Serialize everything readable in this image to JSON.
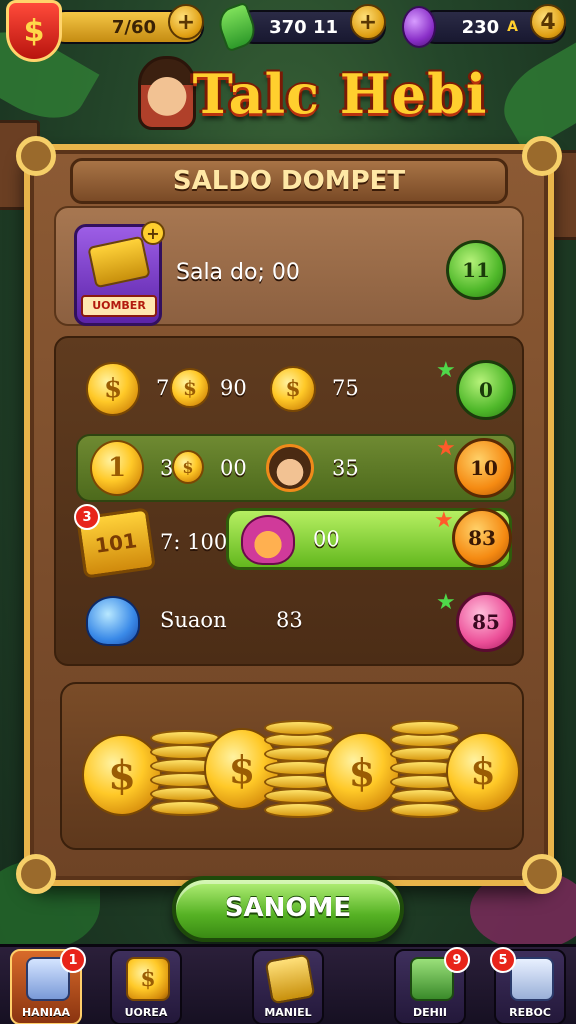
{
  "top_bar": {
    "gold_value": "7/60",
    "leaf_value": "370 11",
    "gem_value": "230",
    "gem_suffix": "A",
    "plus_label": "+",
    "gem_plus_label": "4"
  },
  "title": "Talc Hebi",
  "panel": {
    "header": "SALDO DOMPET",
    "wallet_badge": "UOMBER",
    "wallet_label": "Sala do; 00",
    "wallet_button": "11",
    "rows": [
      {
        "text_a": "7",
        "text_b": "90",
        "text_c": "75",
        "button": "0"
      },
      {
        "text_a": "3",
        "text_b": "00",
        "text_c": "35",
        "button": "10"
      },
      {
        "text_a": "7: 100",
        "text_b": "00",
        "button": "83",
        "dot": "3",
        "cash": "101"
      },
      {
        "text_a": "Suaon",
        "text_b": "83",
        "button": "85"
      }
    ]
  },
  "action_button": "SANOME",
  "bottom_nav": [
    {
      "label": "HANIAA",
      "badge": "1"
    },
    {
      "label": "UOREA"
    },
    {
      "label": "MANIEL"
    },
    {
      "label": "DEHII",
      "badge": "9"
    },
    {
      "label": "REBOC",
      "badge": "5"
    }
  ],
  "colors": {
    "accent_gold": "#ffcf2e",
    "panel_wood": "#8c5a34",
    "button_green": "#56b224",
    "badge_red": "#e8241a"
  }
}
